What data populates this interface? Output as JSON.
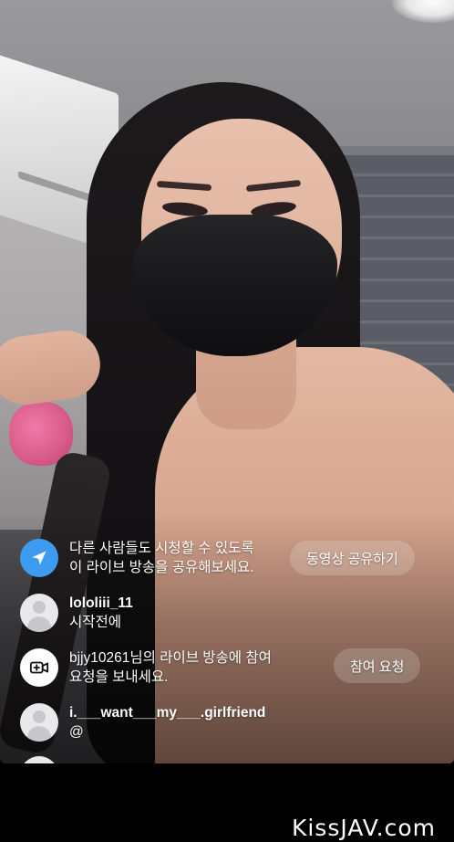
{
  "comments": [
    {
      "kind": "system-share",
      "icon": "send-icon",
      "line1": "다른 사람들도 시청할 수 있도록",
      "line2": "이 라이브 방송을 공유해보세요.",
      "action": "동영상 공유하기"
    },
    {
      "kind": "user-comment",
      "icon": "default-avatar-icon",
      "username": "lololiii_11",
      "text": "시작전에"
    },
    {
      "kind": "system-join-request",
      "icon": "video-call-add-icon",
      "line1": "bjjy10261님의 라이브 방송에 참여",
      "line2": "요청을 보내세요.",
      "action": "참여 요청"
    },
    {
      "kind": "user-comment",
      "icon": "default-avatar-icon",
      "username": "i.___want___my___.girlfriend",
      "text": "@"
    }
  ],
  "watermark": "KissJAV.com"
}
